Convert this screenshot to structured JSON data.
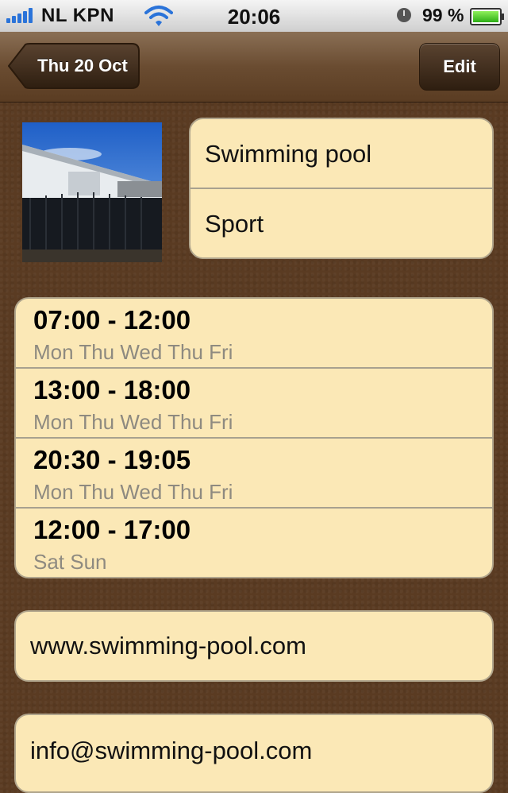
{
  "status_bar": {
    "carrier": "NL KPN",
    "time": "20:06",
    "battery": "99 %"
  },
  "nav": {
    "back_label": "Thu 20 Oct",
    "edit_label": "Edit"
  },
  "place": {
    "name": "Swimming pool",
    "category": "Sport"
  },
  "hours": [
    {
      "time": "07:00 - 12:00",
      "days": "Mon Thu Wed Thu Fri"
    },
    {
      "time": "13:00 - 18:00",
      "days": "Mon Thu Wed Thu Fri"
    },
    {
      "time": "20:30 - 19:05",
      "days": "Mon Thu Wed Thu Fri"
    },
    {
      "time": "12:00 - 17:00",
      "days": "Sat Sun"
    }
  ],
  "contact": {
    "website": "www.swimming-pool.com",
    "email": "info@swimming-pool.com"
  },
  "icons": {
    "signal": "signal-bars-icon",
    "wifi": "wifi-icon",
    "alarm": "alarm-clock-icon",
    "battery": "battery-icon"
  },
  "colors": {
    "card_bg": "#fbe8b6",
    "background": "#5a3b22",
    "signal": "#2a73d9",
    "battery": "#2cae16"
  }
}
